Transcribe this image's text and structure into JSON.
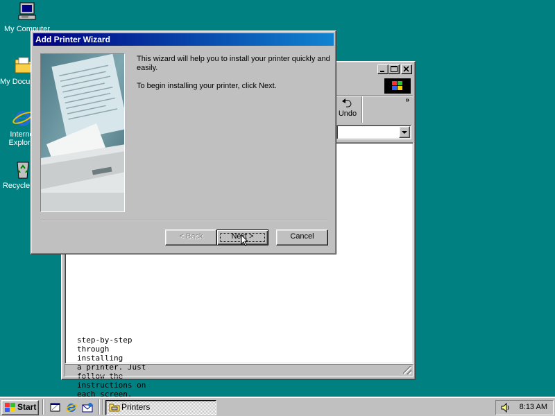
{
  "desktop": {
    "icons": [
      {
        "label": "My Computer"
      },
      {
        "label": "My Documents"
      },
      {
        "label": "Internet Explorer"
      },
      {
        "label": "Recycle Bin"
      }
    ]
  },
  "printers_window": {
    "toolbar_undo_label": "Undo",
    "chevron": "»",
    "content_text": "step-by-step\nthrough installing\na printer. Just\nfollow the\ninstructions on\neach screen."
  },
  "wizard": {
    "title": "Add Printer Wizard",
    "intro": "This wizard will help you to install your printer quickly and easily.",
    "instruction": "To begin installing your printer, click Next.",
    "back_label": "< Back",
    "next_label": "Next >",
    "cancel_label": "Cancel",
    "back_disabled": true
  },
  "taskbar": {
    "start_label": "Start",
    "task_label": "Printers",
    "clock": "8:13 AM"
  },
  "colors": {
    "desktop": "#008080",
    "titlebar_start": "#000080",
    "titlebar_end": "#1084d0",
    "face": "#c0c0c0"
  }
}
